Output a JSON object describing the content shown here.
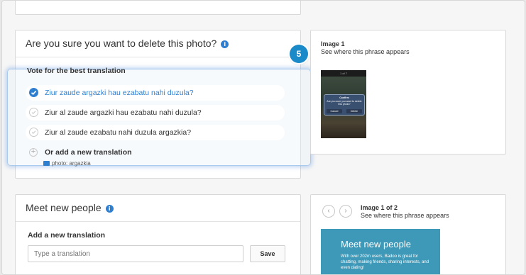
{
  "delete_card": {
    "title": "Are you sure you want to delete this photo?",
    "vote_label": "Vote for the best translation",
    "options": [
      {
        "text": "Ziur zaude argazki hau ezabatu nahi duzula?",
        "selected": true
      },
      {
        "text": "Ziur al zaude argazki hau ezabatu nahi duzula?",
        "selected": false
      },
      {
        "text": "Ziur al zaude ezabatu nahi duzula argazkia?",
        "selected": false
      }
    ],
    "add_label": "Or add a new translation",
    "glossary_hint": "photo: argazkia"
  },
  "tour_step": "5",
  "image_card1": {
    "title": "Image 1",
    "subtitle": "See where this phrase appears"
  },
  "phone_shot": {
    "header": "1 of 7",
    "dialog_title": "Confirm",
    "dialog_body": "Are you sure you want to delete this photo?",
    "cancel": "Cancel",
    "delete": "Delete"
  },
  "meet_card": {
    "title": "Meet new people",
    "add_label": "Add a new translation",
    "placeholder": "Type a translation",
    "save": "Save"
  },
  "image_card2": {
    "title": "Image 1 of 2",
    "subtitle": "See where this phrase appears",
    "prev": "‹",
    "next": "›"
  },
  "promo": {
    "heading": "Meet new people",
    "body": "With over 202m users, Badoo is great for chatting, making friends, sharing interests, and even dating!"
  },
  "colors": {
    "accent": "#2f7fd0",
    "badge": "#1b8ac9",
    "promo_bg": "#3e98b7"
  }
}
